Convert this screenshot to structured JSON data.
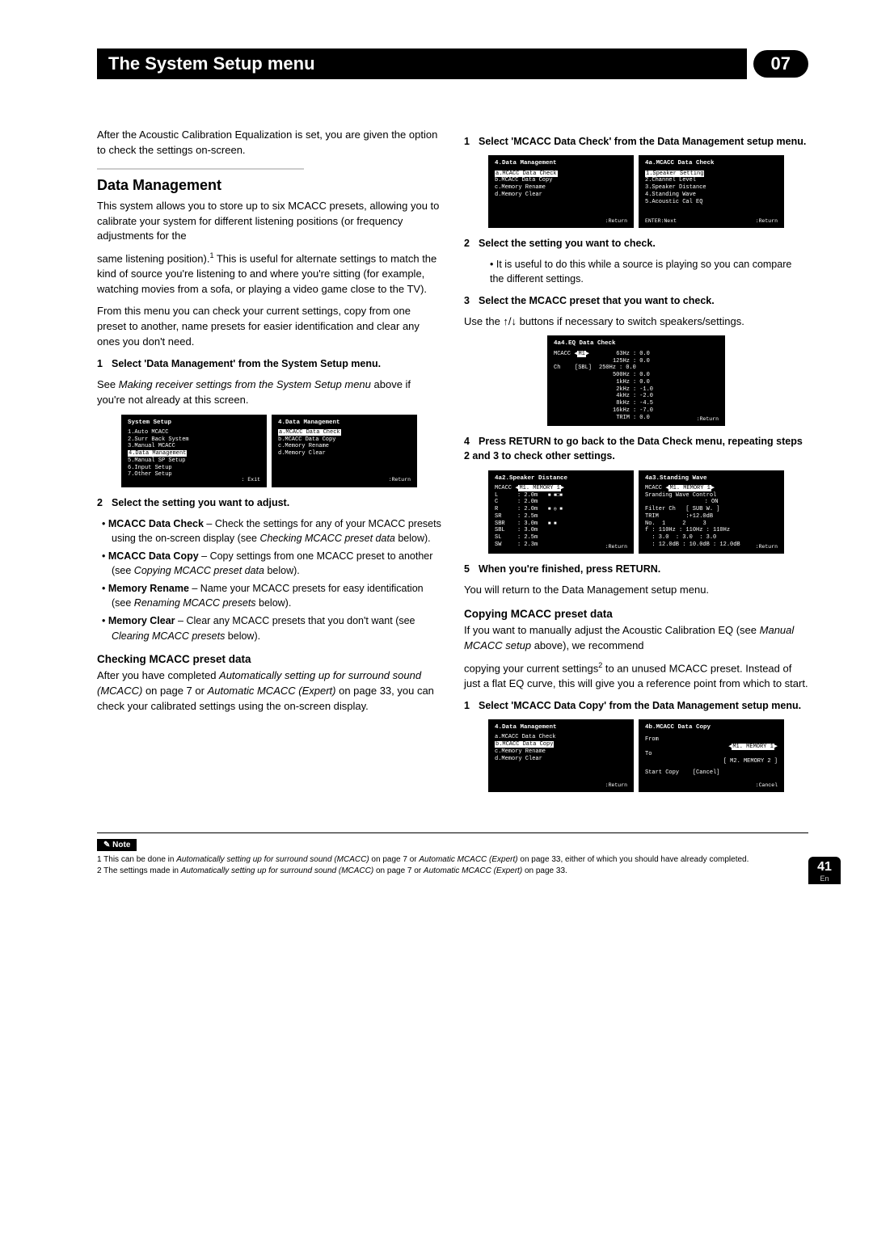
{
  "chapter": {
    "title": "The System Setup menu",
    "num": "07"
  },
  "intro_left": "After the Acoustic Calibration Equalization is set, you are given the option to check the settings on-screen.",
  "dm": {
    "heading": "Data Management",
    "p1a": "This system allows you to store up to six MCACC presets, allowing you to calibrate your system for different listening positions (or frequency adjustments for the",
    "p1b": "same listening position).",
    "sup1": "1",
    "p1c": " This is useful for alternate settings to match the kind of source you're listening to and where you're sitting (for example, watching movies from a sofa, or playing a video game close to the TV).",
    "p2": "From this menu you can check your current settings, copy from one preset to another, name presets for easier identification and clear any ones you don't need.",
    "step1": "Select 'Data Management' from the System Setup menu.",
    "step1_sub_a": "See ",
    "step1_sub_i": "Making receiver settings from the System Setup menu",
    "step1_sub_b": " above if you're not already at this screen.",
    "step2": "Select the setting you want to adjust.",
    "b1_label": "MCACC Data Check",
    "b1_rest": " – Check the settings for any of your MCACC presets using the on-screen display (see ",
    "b1_i": "Checking MCACC preset data",
    "b1_end": " below).",
    "b2_label": "MCACC Data Copy",
    "b2_rest": " – Copy settings from one MCACC preset to another (see ",
    "b2_i": "Copying MCACC preset data",
    "b2_end": " below).",
    "b3_label": "Memory Rename",
    "b3_rest": " – Name your MCACC presets for easy identification (see ",
    "b3_i": "Renaming MCACC presets",
    "b3_end": " below).",
    "b4_label": "Memory Clear",
    "b4_rest": " – Clear any MCACC presets that you don't want (see ",
    "b4_i": "Clearing MCACC presets",
    "b4_end": " below).",
    "h3_check": "Checking MCACC preset data",
    "check_p_a": "After you have completed ",
    "check_p_i1": "Automatically setting up for surround sound (MCACC)",
    "check_p_b": " on page 7 or ",
    "check_p_i2": "Automatic MCACC (Expert)",
    "check_p_c": " on page 33, you can check your calibrated settings using the on-screen display."
  },
  "right": {
    "step1": "Select 'MCACC Data Check' from the Data Management setup menu.",
    "step2": "Select the setting you want to check.",
    "step2_sub": "It is useful to do this while a source is playing so you can compare the different settings.",
    "step3": "Select the MCACC preset that you want to check.",
    "step3_sub_a": "Use the ",
    "step3_sub_b": " buttons if necessary to switch speakers/settings.",
    "step4": "Press RETURN to go back to the Data Check menu, repeating steps 2 and 3 to check other settings.",
    "step5": "When you're finished, press RETURN.",
    "step5_sub": "You will return to the Data Management setup menu.",
    "h3_copy": "Copying MCACC preset data",
    "copy_p_a": "If you want to manually adjust the Acoustic Calibration EQ (see ",
    "copy_p_i": "Manual MCACC setup",
    "copy_p_b": " above), we recommend",
    "copy_p_c": "copying your current settings",
    "sup2": "2",
    "copy_p_d": " to an unused MCACC preset. Instead of just a flat EQ curve, this will give you a reference point from which to start.",
    "copy_step1": "Select 'MCACC Data Copy' from the Data Management setup menu."
  },
  "screens": {
    "systemSetup": {
      "title": "System Setup",
      "items": [
        "1.Auto MCACC",
        "2.Surr Back System",
        "3.Manual MCACC",
        "4.Data Management",
        "5.Manual SP Setup",
        "6.Input Setup",
        "7.Other Setup"
      ],
      "highlight": 3,
      "footer": ": Exit"
    },
    "dataManagement": {
      "title": "4.Data Management",
      "items": [
        "a.MCACC Data Check",
        "b.MCACC Data Copy",
        "c.Memory Rename",
        "d.Memory Clear"
      ],
      "highlight_a": 0,
      "highlight_b": 1,
      "footer": ":Return"
    },
    "dataCheck": {
      "title": "4a.MCACC Data Check",
      "items": [
        "1.Speaker Setting",
        "2.Channel Level",
        "3.Speaker Distance",
        "4.Standing Wave",
        "5.Acoustic Cal EQ"
      ],
      "footerLeft": "ENTER:Next",
      "footer": ":Return"
    },
    "eqCheck": {
      "title": "4a4.EQ Data Check",
      "mcacc": "MCACC",
      "mem": "M1",
      "ch": "Ch",
      "chval": "[SBL]",
      "rows": [
        [
          "63Hz",
          "0.0"
        ],
        [
          "125Hz",
          "0.0"
        ],
        [
          "250Hz",
          "0.0"
        ],
        [
          "500Hz",
          "0.0"
        ],
        [
          "1kHz",
          "0.0"
        ],
        [
          "2kHz",
          "-1.0"
        ],
        [
          "4kHz",
          "-2.0"
        ],
        [
          "8kHz",
          "-4.5"
        ],
        [
          "16kHz",
          "-7.0"
        ],
        [
          "TRIM",
          "0.0"
        ]
      ],
      "footer": ":Return"
    },
    "spkDist": {
      "title": "4a2.Speaker Distance",
      "mcacc": "MCACC",
      "mem": "M1. MEMORY 1",
      "rows": [
        [
          "L",
          "2.0m"
        ],
        [
          "C",
          "2.0m"
        ],
        [
          "R",
          "2.0m"
        ],
        [
          "SR",
          "2.5m"
        ],
        [
          "SBR",
          "3.0m"
        ],
        [
          "SBL",
          "3.0m"
        ],
        [
          "SL",
          "2.5m"
        ],
        [
          "SW",
          "2.3m"
        ]
      ],
      "footer": ":Return"
    },
    "standingWave": {
      "title": "4a3.Standing Wave",
      "mcacc": "MCACC",
      "mem": "M1. MEMORY 1",
      "l1": "Sranding Wave Control",
      "l2": ": ON",
      "l3": "Filter Ch   [ SUB W. ]",
      "l4": "TRIM        :+12.0dB",
      "cols": [
        "No.",
        "1",
        "2",
        "3"
      ],
      "r1": [
        "f",
        ": 110Hz",
        ": 110Hz",
        ": 110Hz"
      ],
      "r2": [
        "",
        ": 3.0",
        ": 3.0",
        ": 3.0"
      ],
      "r3": [
        "",
        ": 12.0dB",
        ": 10.0dB",
        ": 12.0dB"
      ],
      "footer": ":Return"
    },
    "dataCopy": {
      "title": "4b.MCACC Data Copy",
      "from": "From",
      "fromval": "M1. MEMORY 1",
      "to": "To",
      "toval": "[ M2. MEMORY 2 ]",
      "start": "Start Copy",
      "cancel": "[Cancel]",
      "footer": ":Cancel"
    }
  },
  "notes": {
    "label": "Note",
    "n1_a": "1 This can be done in ",
    "n1_i1": "Automatically setting up for surround sound (MCACC)",
    "n1_b": " on page 7 or ",
    "n1_i2": "Automatic MCACC (Expert)",
    "n1_c": " on page 33, either of which you should have already completed.",
    "n2_a": "2 The settings made in ",
    "n2_i1": "Automatically setting up for surround sound (MCACC)",
    "n2_b": " on page 7 or ",
    "n2_i2": "Automatic MCACC (Expert)",
    "n2_c": " on page 33."
  },
  "page": {
    "num": "41",
    "lang": "En"
  },
  "labels": {
    "step_prefix": [
      "1",
      "2",
      "3",
      "4",
      "5"
    ]
  }
}
